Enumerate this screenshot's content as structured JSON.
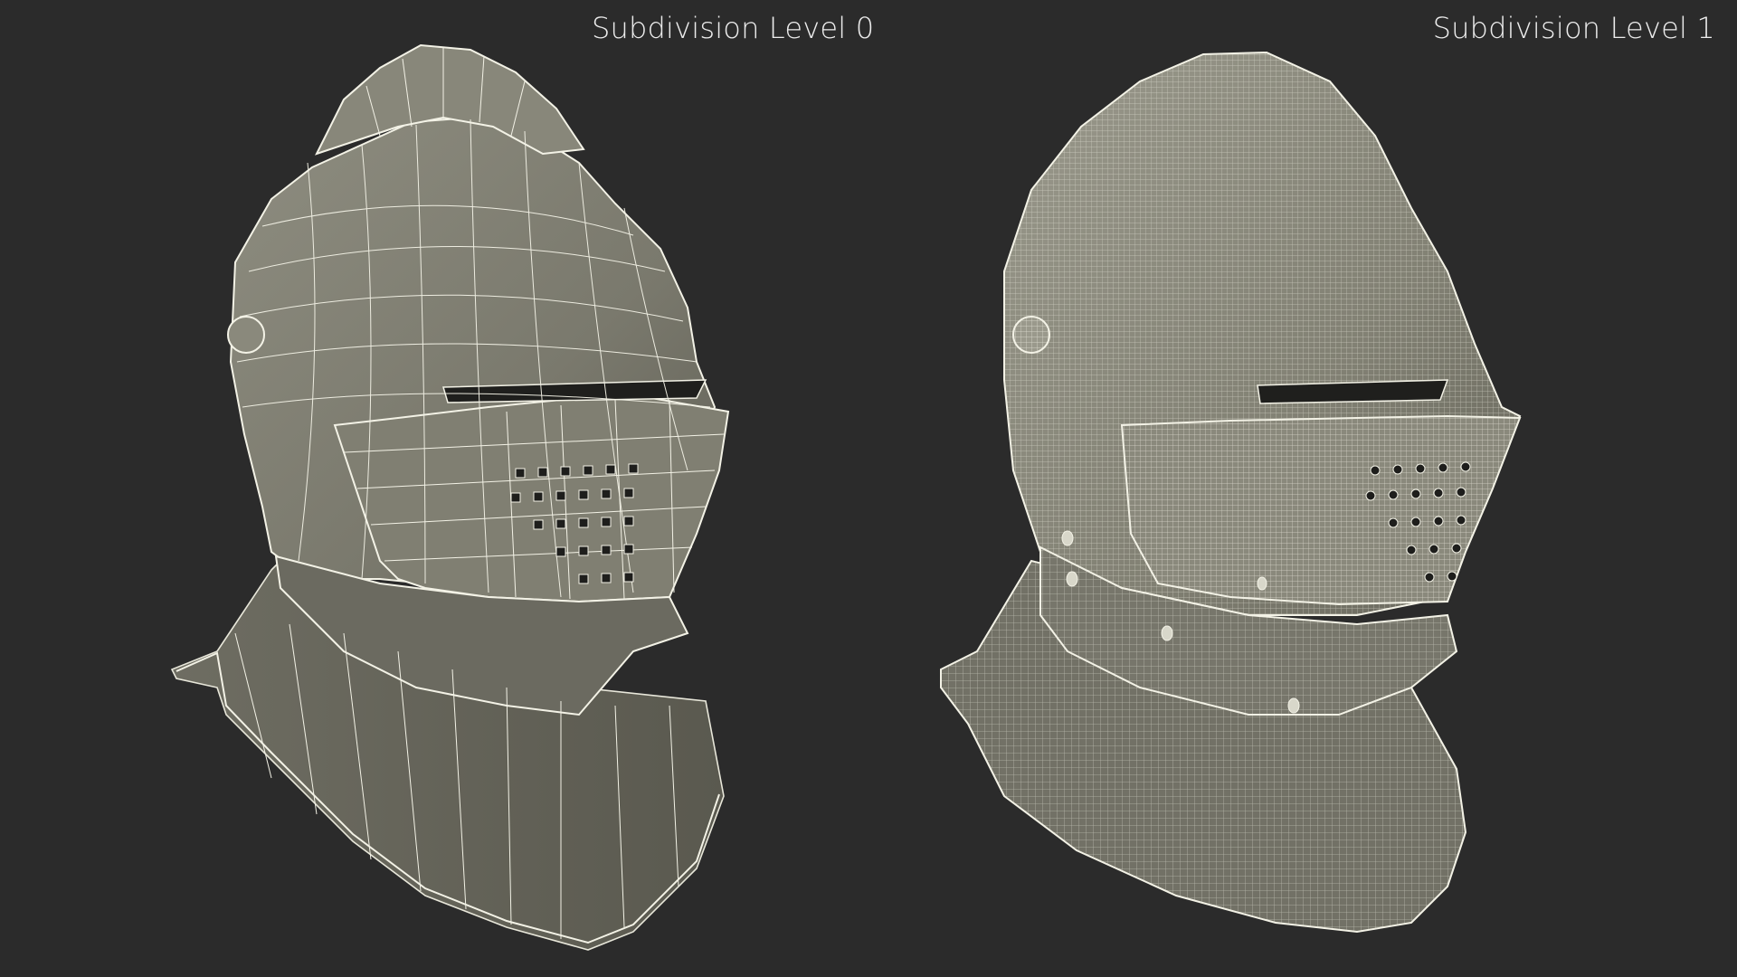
{
  "labels": {
    "left": "Subdivision Level 0",
    "right": "Subdivision Level 1"
  },
  "renders": [
    {
      "name": "helmet-subdivision-0",
      "subdivision": 0
    },
    {
      "name": "helmet-subdivision-1",
      "subdivision": 1
    }
  ],
  "colors": {
    "background": "#2b2b2b",
    "surface": "#7b7a6e",
    "surface_light": "#9a998b",
    "surface_dark": "#5a594f",
    "wire": "#f3f2e6",
    "label": "#ececec"
  }
}
